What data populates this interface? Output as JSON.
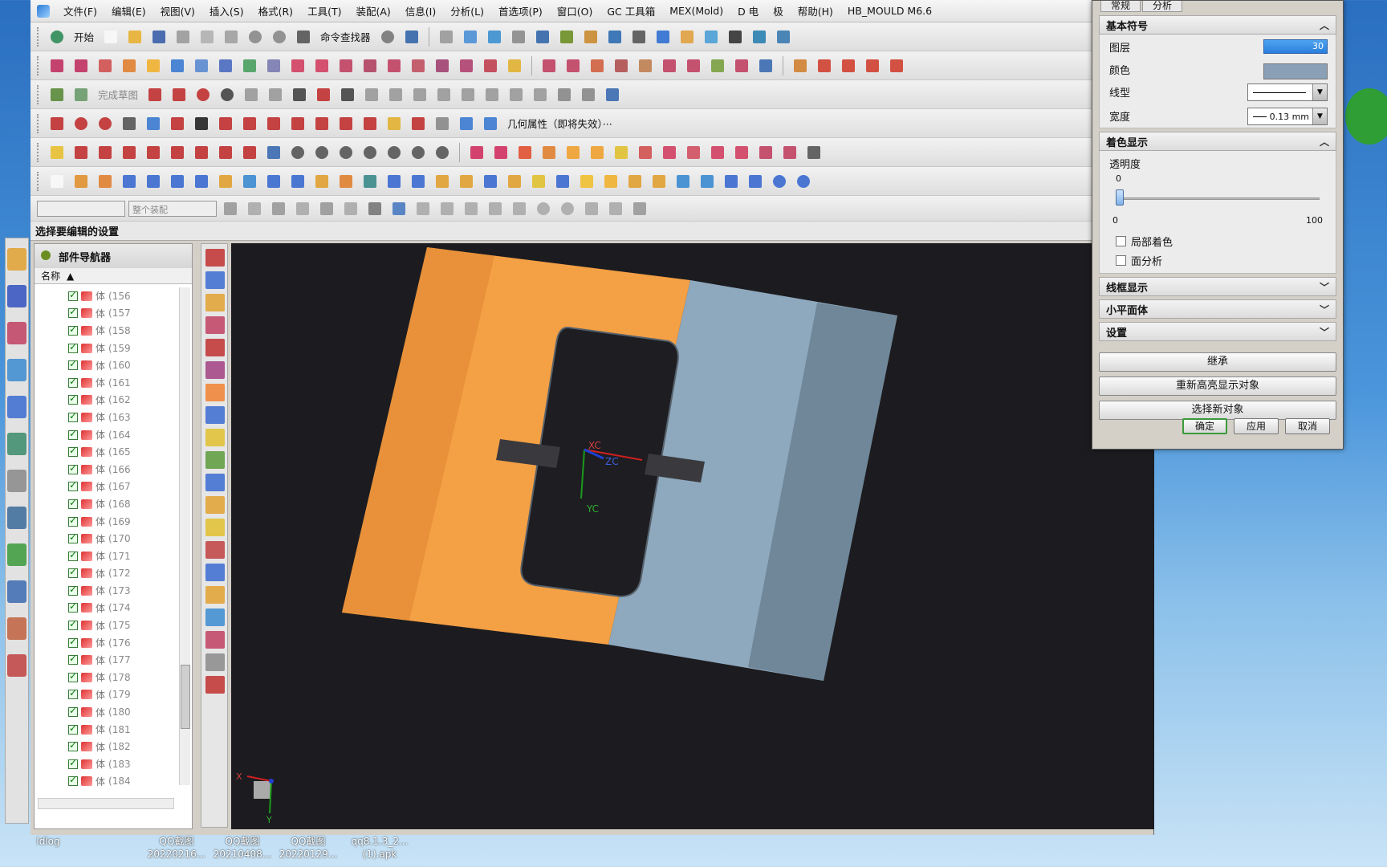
{
  "menu": {
    "items": [
      "文件(F)",
      "编辑(E)",
      "视图(V)",
      "插入(S)",
      "格式(R)",
      "工具(T)",
      "装配(A)",
      "信息(I)",
      "分析(L)",
      "首选项(P)",
      "窗口(O)",
      "GC 工具箱",
      "MEX(Mold)",
      "D 电",
      "极",
      "帮助(H)",
      "HB_MOULD M6.6"
    ]
  },
  "toolbar": {
    "start_label": "开始",
    "command_finder_label": "命令查找器",
    "finish_sketch_label": "完成草图",
    "geometry_props_label": "几何属性（即将失效）···",
    "filter_combo_placeholder": "",
    "assembly_combo_placeholder": "整个装配"
  },
  "status": {
    "prompt": "选择要编辑的设置"
  },
  "navigator": {
    "title": "部件导航器",
    "column_name": "名称",
    "row_prefix": "体",
    "rows": [
      "(156",
      "(157",
      "(158",
      "(159",
      "(160",
      "(161",
      "(162",
      "(163",
      "(164",
      "(165",
      "(166",
      "(167",
      "(168",
      "(169",
      "(170",
      "(171",
      "(172",
      "(173",
      "(174",
      "(175",
      "(176",
      "(177",
      "(178",
      "(179",
      "(180",
      "(181",
      "(182",
      "(183",
      "(184"
    ]
  },
  "viewport": {
    "axis_xc": "XC",
    "axis_yc": "YC",
    "axis_zc": "ZC",
    "triad_x": "X",
    "triad_y": "Y",
    "colors": {
      "orange": "#f4a045",
      "blue": "#8ea8bd",
      "background": "#1c1c20"
    }
  },
  "dialog": {
    "tab_general": "常规",
    "tab_analysis": "分析",
    "basic_symbol": {
      "title": "基本符号",
      "layer_label": "图层",
      "layer_value": "30",
      "color_label": "颜色",
      "color_value": "#8aa0b6",
      "linetype_label": "线型",
      "width_label": "宽度",
      "width_value": "0.13 mm"
    },
    "shading": {
      "title": "着色显示",
      "transparency_label": "透明度",
      "transparency_value": "0",
      "slider_min": "0",
      "slider_max": "100",
      "partial_shading_label": "局部着色",
      "face_analysis_label": "面分析"
    },
    "wireframe_title": "线框显示",
    "facet_title": "小平面体",
    "settings_title": "设置",
    "inherit_label": "继承",
    "rehighlight_label": "重新高亮显示对象",
    "select_new_label": "选择新对象",
    "ok_label": "确定",
    "apply_label": "应用",
    "cancel_label": "取消"
  },
  "desktop": {
    "items": [
      {
        "line1": "ldlog",
        "line2": ""
      },
      {
        "line1": "QQ截图",
        "line2": "20220216..."
      },
      {
        "line1": "QQ截图",
        "line2": "20210408..."
      },
      {
        "line1": "QQ截图",
        "line2": "20220129..."
      },
      {
        "line1": "qq8.1.3_2...",
        "line2": "(1).apk"
      }
    ]
  }
}
